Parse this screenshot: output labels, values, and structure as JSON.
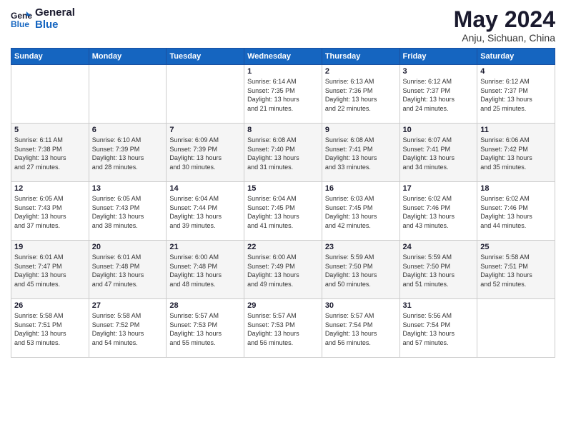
{
  "logo": {
    "line1": "General",
    "line2": "Blue"
  },
  "title": "May 2024",
  "location": "Anju, Sichuan, China",
  "weekdays": [
    "Sunday",
    "Monday",
    "Tuesday",
    "Wednesday",
    "Thursday",
    "Friday",
    "Saturday"
  ],
  "weeks": [
    [
      {
        "num": "",
        "info": ""
      },
      {
        "num": "",
        "info": ""
      },
      {
        "num": "",
        "info": ""
      },
      {
        "num": "1",
        "info": "Sunrise: 6:14 AM\nSunset: 7:35 PM\nDaylight: 13 hours\nand 21 minutes."
      },
      {
        "num": "2",
        "info": "Sunrise: 6:13 AM\nSunset: 7:36 PM\nDaylight: 13 hours\nand 22 minutes."
      },
      {
        "num": "3",
        "info": "Sunrise: 6:12 AM\nSunset: 7:37 PM\nDaylight: 13 hours\nand 24 minutes."
      },
      {
        "num": "4",
        "info": "Sunrise: 6:12 AM\nSunset: 7:37 PM\nDaylight: 13 hours\nand 25 minutes."
      }
    ],
    [
      {
        "num": "5",
        "info": "Sunrise: 6:11 AM\nSunset: 7:38 PM\nDaylight: 13 hours\nand 27 minutes."
      },
      {
        "num": "6",
        "info": "Sunrise: 6:10 AM\nSunset: 7:39 PM\nDaylight: 13 hours\nand 28 minutes."
      },
      {
        "num": "7",
        "info": "Sunrise: 6:09 AM\nSunset: 7:39 PM\nDaylight: 13 hours\nand 30 minutes."
      },
      {
        "num": "8",
        "info": "Sunrise: 6:08 AM\nSunset: 7:40 PM\nDaylight: 13 hours\nand 31 minutes."
      },
      {
        "num": "9",
        "info": "Sunrise: 6:08 AM\nSunset: 7:41 PM\nDaylight: 13 hours\nand 33 minutes."
      },
      {
        "num": "10",
        "info": "Sunrise: 6:07 AM\nSunset: 7:41 PM\nDaylight: 13 hours\nand 34 minutes."
      },
      {
        "num": "11",
        "info": "Sunrise: 6:06 AM\nSunset: 7:42 PM\nDaylight: 13 hours\nand 35 minutes."
      }
    ],
    [
      {
        "num": "12",
        "info": "Sunrise: 6:05 AM\nSunset: 7:43 PM\nDaylight: 13 hours\nand 37 minutes."
      },
      {
        "num": "13",
        "info": "Sunrise: 6:05 AM\nSunset: 7:43 PM\nDaylight: 13 hours\nand 38 minutes."
      },
      {
        "num": "14",
        "info": "Sunrise: 6:04 AM\nSunset: 7:44 PM\nDaylight: 13 hours\nand 39 minutes."
      },
      {
        "num": "15",
        "info": "Sunrise: 6:04 AM\nSunset: 7:45 PM\nDaylight: 13 hours\nand 41 minutes."
      },
      {
        "num": "16",
        "info": "Sunrise: 6:03 AM\nSunset: 7:45 PM\nDaylight: 13 hours\nand 42 minutes."
      },
      {
        "num": "17",
        "info": "Sunrise: 6:02 AM\nSunset: 7:46 PM\nDaylight: 13 hours\nand 43 minutes."
      },
      {
        "num": "18",
        "info": "Sunrise: 6:02 AM\nSunset: 7:46 PM\nDaylight: 13 hours\nand 44 minutes."
      }
    ],
    [
      {
        "num": "19",
        "info": "Sunrise: 6:01 AM\nSunset: 7:47 PM\nDaylight: 13 hours\nand 45 minutes."
      },
      {
        "num": "20",
        "info": "Sunrise: 6:01 AM\nSunset: 7:48 PM\nDaylight: 13 hours\nand 47 minutes."
      },
      {
        "num": "21",
        "info": "Sunrise: 6:00 AM\nSunset: 7:48 PM\nDaylight: 13 hours\nand 48 minutes."
      },
      {
        "num": "22",
        "info": "Sunrise: 6:00 AM\nSunset: 7:49 PM\nDaylight: 13 hours\nand 49 minutes."
      },
      {
        "num": "23",
        "info": "Sunrise: 5:59 AM\nSunset: 7:50 PM\nDaylight: 13 hours\nand 50 minutes."
      },
      {
        "num": "24",
        "info": "Sunrise: 5:59 AM\nSunset: 7:50 PM\nDaylight: 13 hours\nand 51 minutes."
      },
      {
        "num": "25",
        "info": "Sunrise: 5:58 AM\nSunset: 7:51 PM\nDaylight: 13 hours\nand 52 minutes."
      }
    ],
    [
      {
        "num": "26",
        "info": "Sunrise: 5:58 AM\nSunset: 7:51 PM\nDaylight: 13 hours\nand 53 minutes."
      },
      {
        "num": "27",
        "info": "Sunrise: 5:58 AM\nSunset: 7:52 PM\nDaylight: 13 hours\nand 54 minutes."
      },
      {
        "num": "28",
        "info": "Sunrise: 5:57 AM\nSunset: 7:53 PM\nDaylight: 13 hours\nand 55 minutes."
      },
      {
        "num": "29",
        "info": "Sunrise: 5:57 AM\nSunset: 7:53 PM\nDaylight: 13 hours\nand 56 minutes."
      },
      {
        "num": "30",
        "info": "Sunrise: 5:57 AM\nSunset: 7:54 PM\nDaylight: 13 hours\nand 56 minutes."
      },
      {
        "num": "31",
        "info": "Sunrise: 5:56 AM\nSunset: 7:54 PM\nDaylight: 13 hours\nand 57 minutes."
      },
      {
        "num": "",
        "info": ""
      }
    ]
  ]
}
